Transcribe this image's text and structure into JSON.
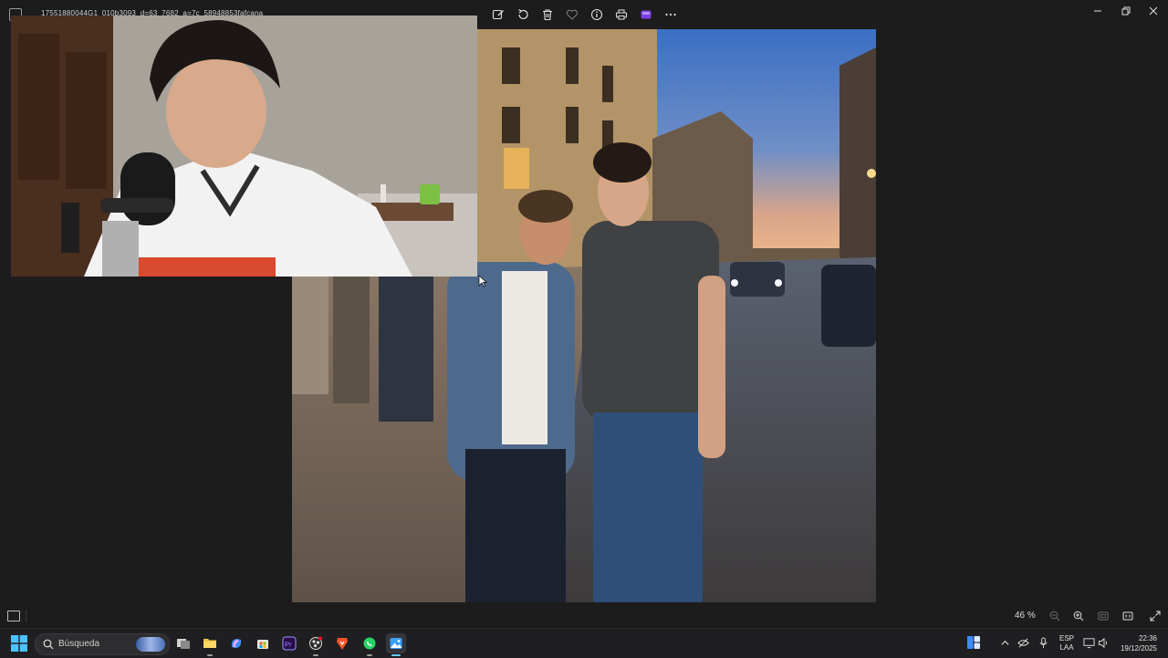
{
  "window": {
    "filename": "17551880044G1_010b3093_d=63_7682_a=7c_58948853fafcana",
    "toolbar": [
      {
        "name": "edit-image-button",
        "icon": "edit-icon"
      },
      {
        "name": "rotate-button",
        "icon": "rotate-icon"
      },
      {
        "name": "delete-button",
        "icon": "trash-icon"
      },
      {
        "name": "favorite-button",
        "icon": "heart-icon"
      },
      {
        "name": "info-button",
        "icon": "info-icon"
      },
      {
        "name": "print-button",
        "icon": "printer-icon"
      },
      {
        "name": "clipchamp-button",
        "icon": "clipchamp-icon"
      },
      {
        "name": "more-button",
        "icon": "more-icon"
      }
    ],
    "controls": [
      "minimize",
      "maximize",
      "close"
    ]
  },
  "statusbar": {
    "zoom_label": "46 %"
  },
  "taskbar": {
    "search_placeholder": "Búsqueda",
    "apps": [
      "task-view",
      "file-explorer",
      "copilot",
      "microsoft-store",
      "premiere-pro",
      "obs-studio",
      "brave-browser",
      "whatsapp",
      "photos"
    ],
    "language_line1": "ESP",
    "language_line2": "LAA",
    "time": "22:36",
    "date": "19/12/2025"
  },
  "colors": {
    "accent": "#60cdff",
    "background": "#1c1c1c",
    "taskbar": "#1f1f22"
  }
}
